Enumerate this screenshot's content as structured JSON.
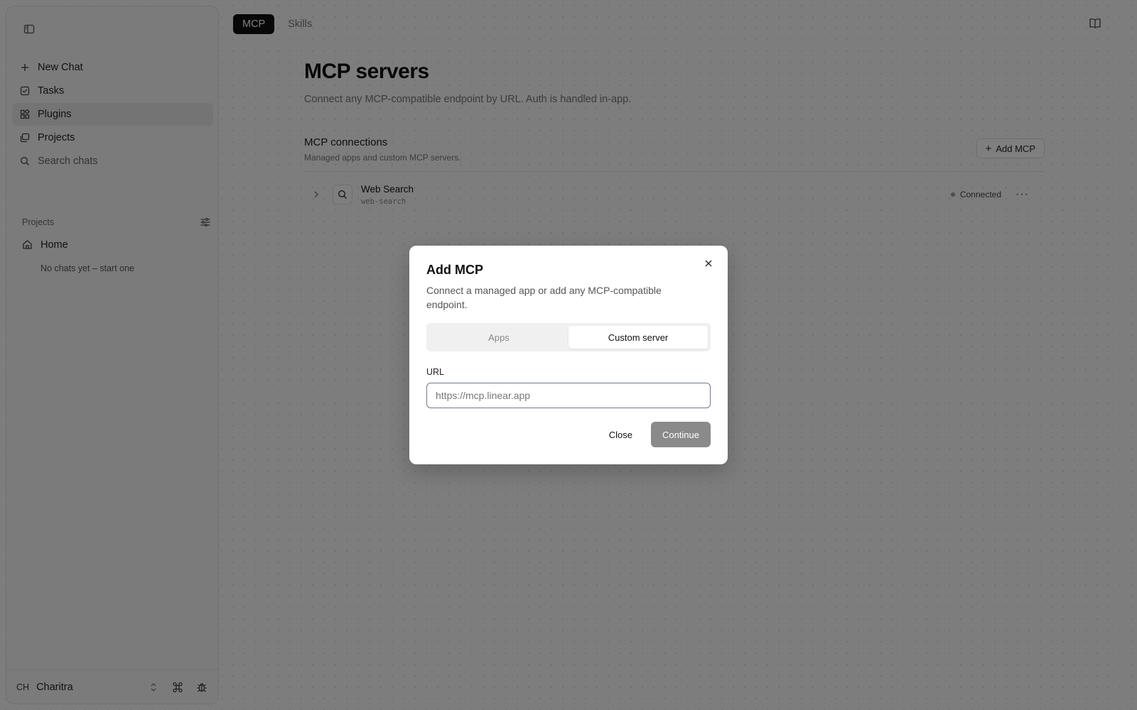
{
  "sidebar": {
    "nav": [
      {
        "label": "New Chat",
        "icon": "plus-icon"
      },
      {
        "label": "Tasks",
        "icon": "checkbox-icon"
      },
      {
        "label": "Plugins",
        "icon": "plugins-icon",
        "active": true
      },
      {
        "label": "Projects",
        "icon": "projects-icon"
      },
      {
        "label": "Search chats",
        "icon": "search-icon"
      }
    ],
    "projects_heading": "Projects",
    "home_label": "Home",
    "empty_text": "No chats yet – start one",
    "user_initials": "CH",
    "user_name": "Charitra"
  },
  "tabs": [
    {
      "label": "MCP",
      "active": true
    },
    {
      "label": "Skills",
      "active": false
    }
  ],
  "main": {
    "title": "MCP servers",
    "subtitle": "Connect any MCP-compatible endpoint by URL. Auth is handled in-app.",
    "section_title": "MCP connections",
    "section_subtitle": "Managed apps and custom MCP servers.",
    "add_button": "Add MCP",
    "servers": [
      {
        "name": "Web Search",
        "slug": "web-search",
        "status": "Connected"
      }
    ]
  },
  "modal": {
    "title": "Add MCP",
    "description": "Connect a managed app or add any MCP-compatible endpoint.",
    "segments": [
      "Apps",
      "Custom server"
    ],
    "active_segment": "Custom server",
    "url_label": "URL",
    "url_placeholder": "https://mcp.linear.app",
    "url_value": "",
    "close_label": "Close",
    "continue_label": "Continue"
  },
  "colors": {
    "overlay": "#00000080",
    "active_tab": "#111111",
    "primary_disabled": "#8a8a8a"
  }
}
